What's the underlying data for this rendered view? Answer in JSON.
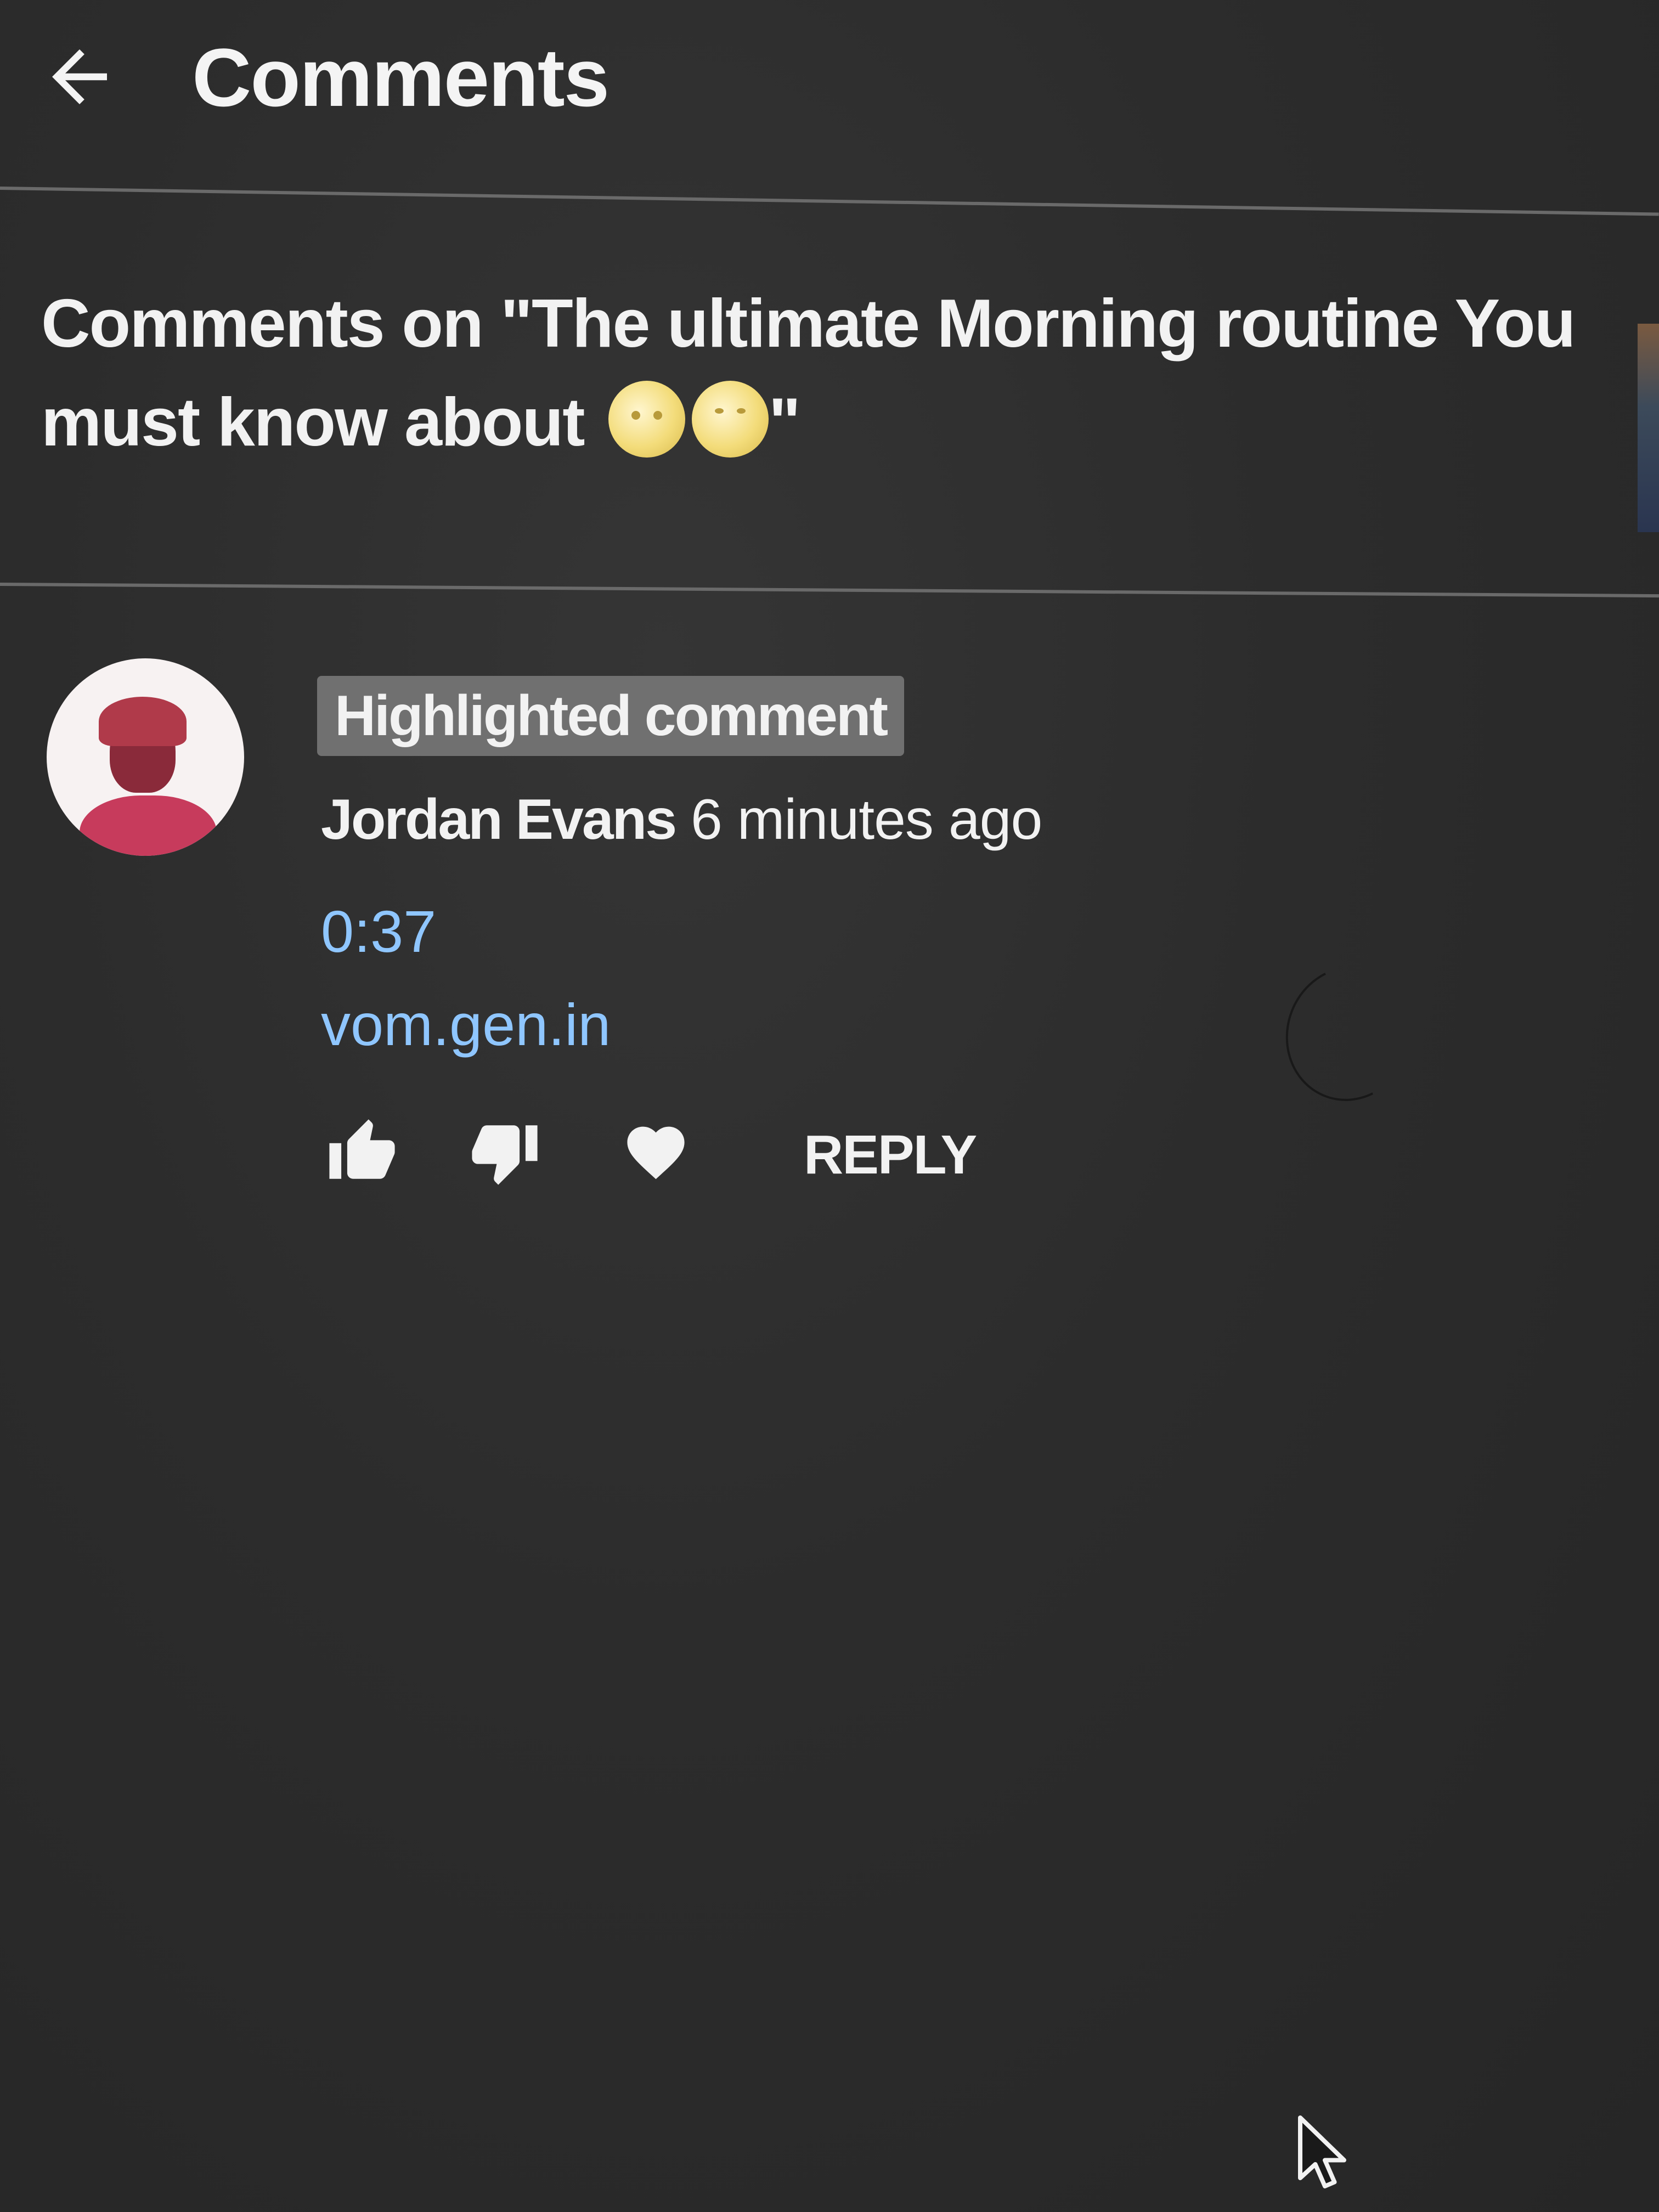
{
  "header": {
    "back_icon": "arrow-left-icon",
    "title": "Comments"
  },
  "video": {
    "title_prefix": "Comments on \"The ultimate Morning routine You must know about ",
    "title_suffix": "\"",
    "emojis": [
      "smiling-face-icon",
      "laughing-face-icon"
    ]
  },
  "comment": {
    "badge": "Highlighted comment",
    "author": "Jordan Evans",
    "time": "6 minutes ago",
    "timestamp": "0:37",
    "link": "vom.gen.in",
    "actions": {
      "like_icon": "thumbs-up-icon",
      "dislike_icon": "thumbs-down-icon",
      "heart_icon": "heart-icon",
      "reply_label": "REPLY"
    }
  },
  "colors": {
    "background": "#2b2b2b",
    "text": "#f2f2f2",
    "link": "#8fc6ff",
    "badge": "#707070",
    "divider": "#6a6a6a"
  }
}
